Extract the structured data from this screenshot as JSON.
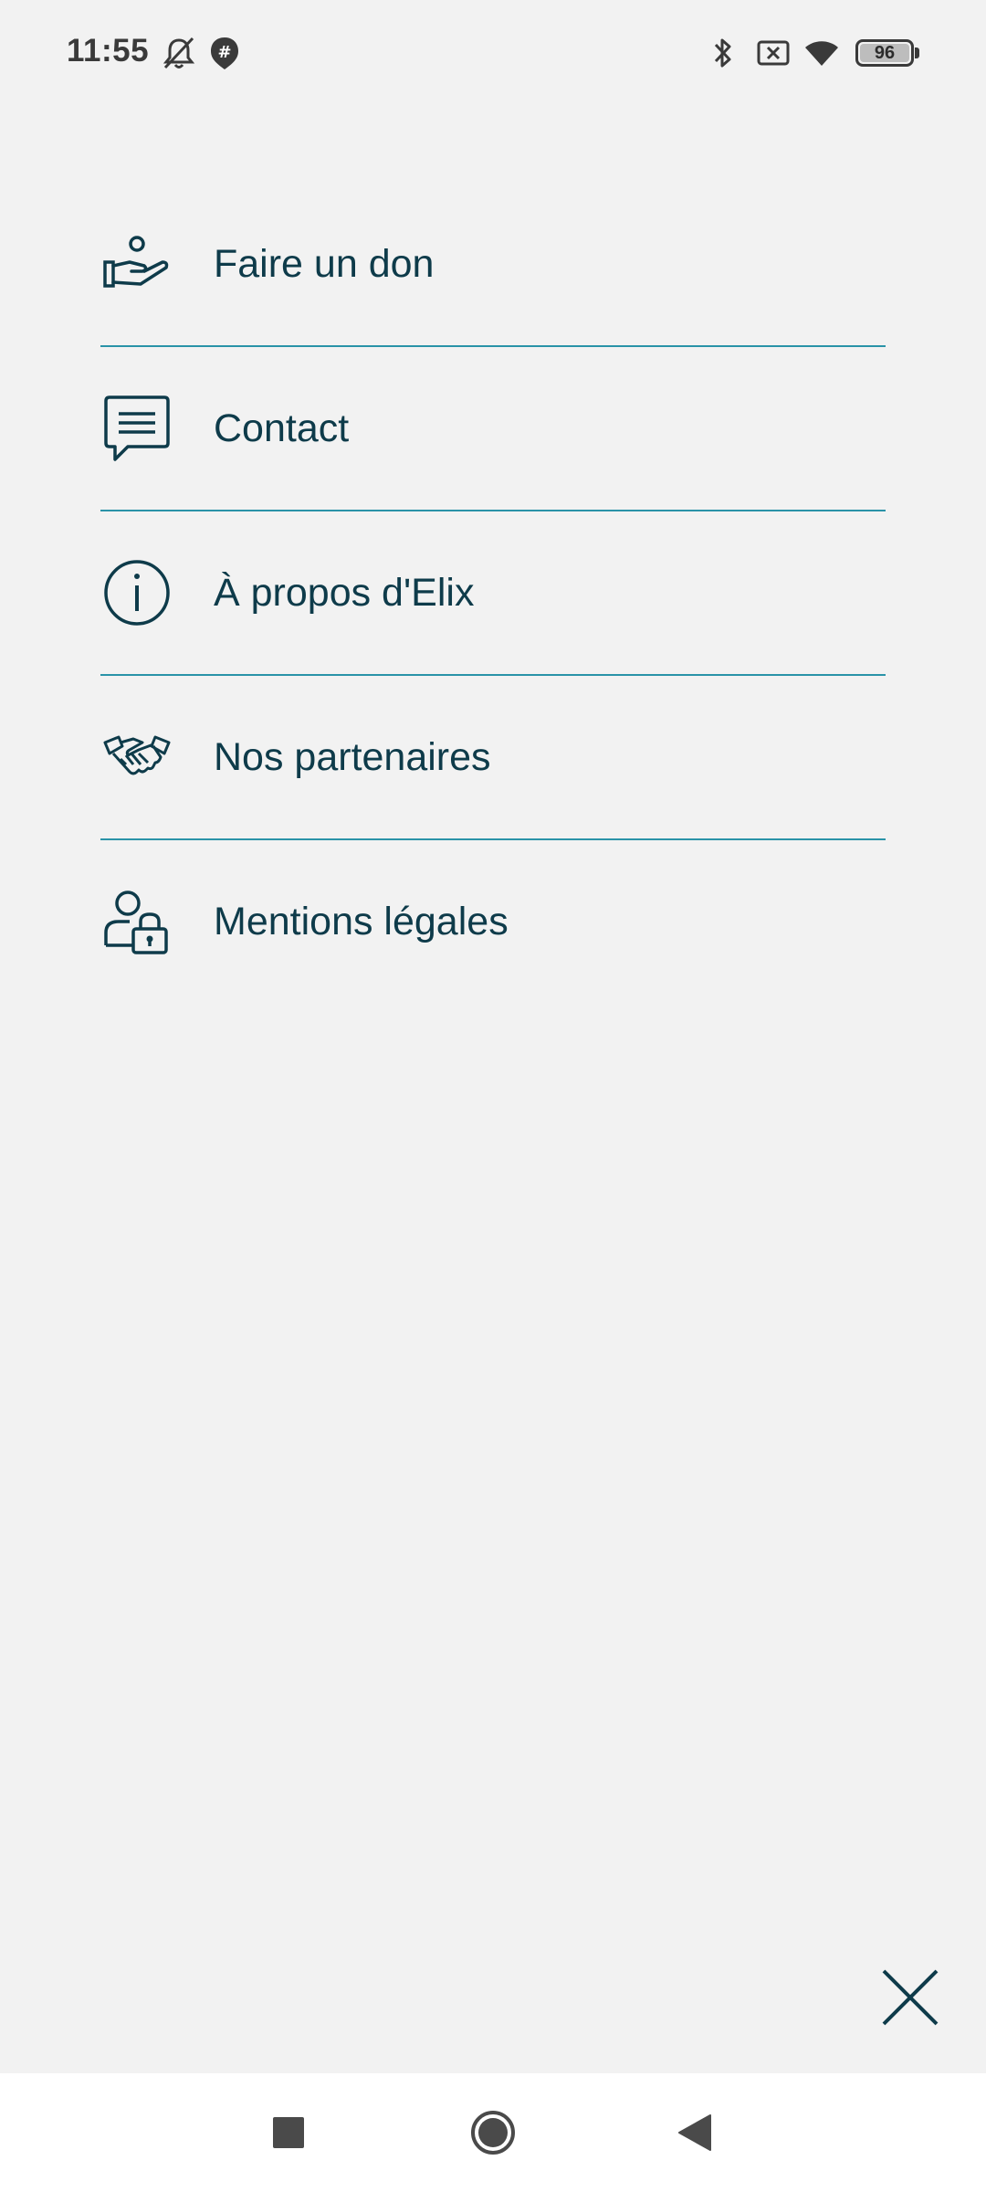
{
  "status_bar": {
    "time": "11:55",
    "battery_level": "96",
    "icons": [
      "mute-bell-icon",
      "hashtag-notification-icon",
      "bluetooth-icon",
      "no-sim-icon",
      "wifi-icon",
      "battery-icon"
    ]
  },
  "menu": {
    "items": [
      {
        "label": "Faire un don",
        "icon": "donate-hand-icon"
      },
      {
        "label": "Contact",
        "icon": "chat-bubble-icon"
      },
      {
        "label": "À propos d'Elix",
        "icon": "info-icon"
      },
      {
        "label": "Nos partenaires",
        "icon": "handshake-icon"
      },
      {
        "label": "Mentions légales",
        "icon": "user-lock-icon"
      }
    ]
  },
  "close": {
    "icon": "close-icon"
  },
  "nav_bar": {
    "buttons": [
      "recents-square-icon",
      "home-circle-icon",
      "back-triangle-icon"
    ]
  },
  "colors": {
    "background": "#f2f2f2",
    "text": "#0e3b4a",
    "divider": "#2a93a8"
  }
}
